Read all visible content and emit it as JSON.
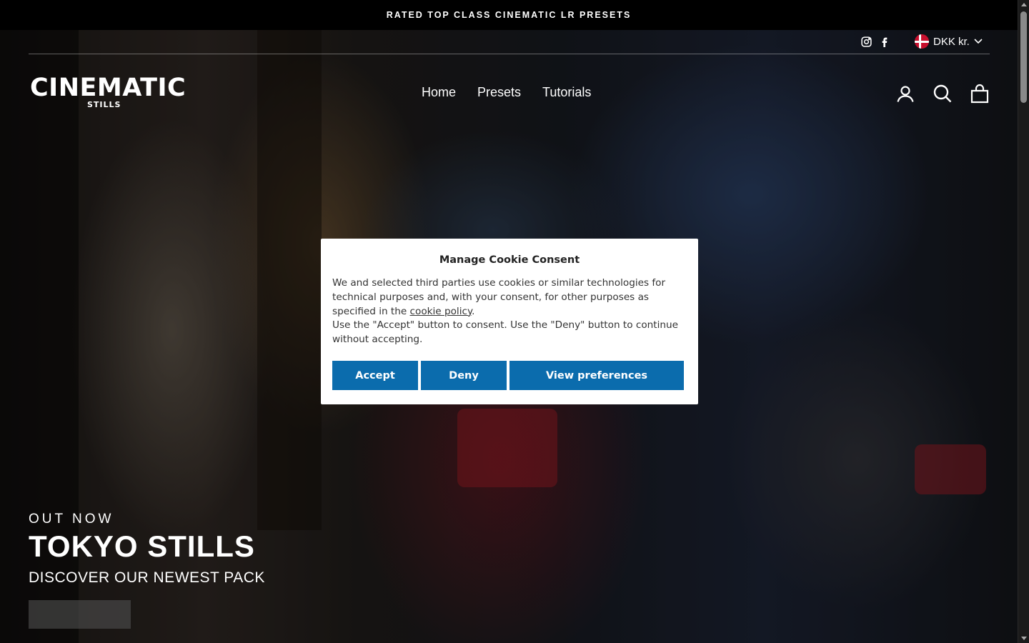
{
  "announcement": {
    "text": "RATED TOP CLASS CINEMATIC LR PRESETS"
  },
  "header": {
    "social": [
      {
        "name": "instagram-icon",
        "label": "Instagram"
      },
      {
        "name": "facebook-icon",
        "label": "Facebook"
      }
    ],
    "currency": {
      "label": "DKK kr.",
      "flag": "denmark-flag-icon"
    },
    "logo": {
      "main": "CINEMATIC",
      "sub": "STILLS"
    },
    "nav": [
      {
        "label": "Home"
      },
      {
        "label": "Presets"
      },
      {
        "label": "Tutorials"
      }
    ],
    "icons": [
      "account-icon",
      "search-icon",
      "cart-icon"
    ]
  },
  "hero": {
    "eyebrow": "OUT NOW",
    "title": "TOKYO STILLS",
    "subtitle": "DISCOVER OUR NEWEST PACK",
    "button_label": ""
  },
  "cookie": {
    "title": "Manage Cookie Consent",
    "body_1": "We and selected third parties use cookies or similar technologies for technical purposes and, with your consent, for other purposes as specified in the ",
    "link": "cookie policy",
    "body_2": ".",
    "body_3": "Use the \"Accept\" button to consent. Use the \"Deny\" button to continue without accepting.",
    "buttons": {
      "accept": "Accept",
      "deny": "Deny",
      "preferences": "View preferences"
    },
    "button_color": "#0b6cad"
  }
}
